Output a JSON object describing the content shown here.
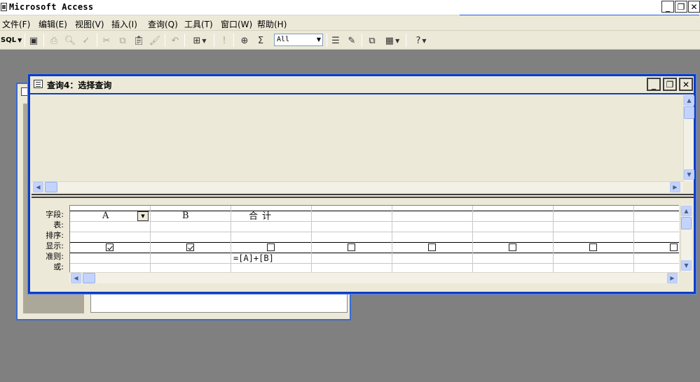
{
  "app": {
    "title": "Microsoft Access",
    "controls": {
      "minimize": "_",
      "restore": "❐",
      "close": "✕"
    }
  },
  "menu": {
    "items": [
      "文件(F)",
      "编辑(E)",
      "视图(V)",
      "插入(I)",
      "查询(Q)",
      "工具(T)",
      "窗口(W)",
      "帮助(H)"
    ]
  },
  "toolbar": {
    "view_label": "SQL",
    "combo_value": "All",
    "icons": [
      "save-icon",
      "print-icon",
      "print-preview-icon",
      "spellcheck-icon",
      "cut-icon",
      "copy-icon",
      "paste-icon",
      "format-painter-icon",
      "undo-icon",
      "query-type-icon",
      "run-icon",
      "show-table-icon",
      "totals-icon",
      "properties-icon",
      "build-icon",
      "database-window-icon",
      "new-object-icon",
      "help-icon"
    ]
  },
  "query_window": {
    "title": "查询4：选择查询",
    "controls": {
      "minimize": "_",
      "restore": "❐",
      "close": "✕"
    }
  },
  "grid": {
    "row_labels": [
      "字段:",
      "表:",
      "排序:",
      "显示:",
      "准则:",
      "或:"
    ],
    "fields": [
      "A",
      "B",
      "合计",
      "",
      "",
      "",
      "",
      ""
    ],
    "show": [
      true,
      true,
      false,
      false,
      false,
      false,
      false,
      false
    ],
    "criteria": [
      "",
      "",
      "=[A]+[B]",
      "",
      "",
      "",
      "",
      ""
    ]
  }
}
